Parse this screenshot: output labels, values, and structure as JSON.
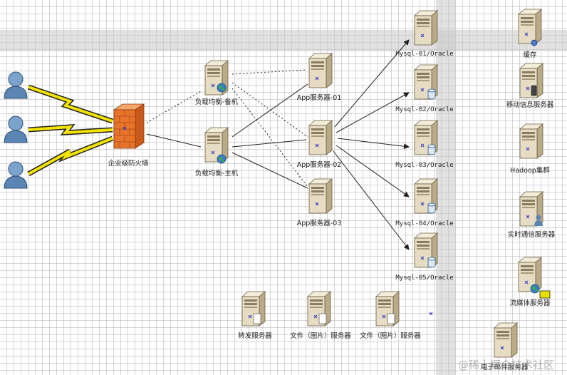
{
  "labels": {
    "firewall": "企业级防火墙",
    "lb_backup": "负载均衡-备机",
    "lb_main": "负载均衡-主机",
    "app1": "App服务器-01",
    "app2": "App服务器-02",
    "app3": "App服务器-03",
    "mysql1": "Mysql-01/Oracle",
    "mysql2": "Mysql-02/Oracle",
    "mysql3": "Mysql-03/Oracle",
    "mysql4": "Mysql-04/Oracle",
    "mysql5": "Mysql-05/Oracle",
    "cache": "缓存",
    "mobile": "移动信息服务器",
    "hadoop": "Hadoop集群",
    "im": "实时通信服务器",
    "streaming": "流媒体服务器",
    "mail": "电子邮件服务器",
    "forward": "转发服务器",
    "file1": "文件（图片）服务器",
    "file2": "文件（图片）服务器"
  },
  "watermark": "@稀土掘金技术社区",
  "colors": {
    "server_body": "#e6dcc4",
    "server_front": "#d3c6a6",
    "firewall": "#e8742a",
    "user": "#5b86b3",
    "lightning": "#f3e300",
    "grid_band": "#c8c8c8"
  }
}
